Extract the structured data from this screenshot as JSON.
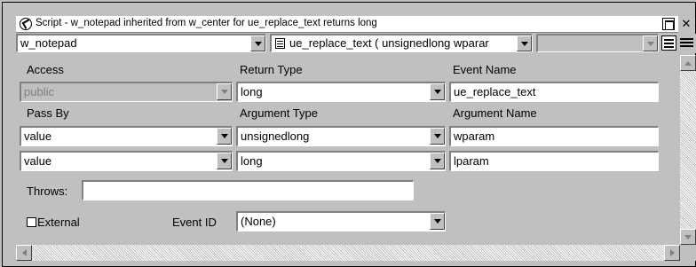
{
  "window": {
    "title": "Script - w_notepad inherited from w_center for ue_replace_text returns long",
    "icon": "script-icon"
  },
  "toolbar": {
    "object_select": "w_notepad",
    "event_select": "ue_replace_text ( unsignedlong wparar",
    "ancestor_select": ""
  },
  "form": {
    "access_label": "Access",
    "access_value": "public",
    "return_type_label": "Return Type",
    "return_type_value": "long",
    "event_name_label": "Event Name",
    "event_name_value": "ue_replace_text",
    "pass_by_label": "Pass By",
    "argument_type_label": "Argument Type",
    "argument_name_label": "Argument Name",
    "arguments": [
      {
        "pass_by": "value",
        "type": "unsignedlong",
        "name": "wparam"
      },
      {
        "pass_by": "value",
        "type": "long",
        "name": "lparam"
      }
    ],
    "throws_label": "Throws:",
    "throws_value": "",
    "external_label": "External",
    "external_checked": false,
    "event_id_label": "Event ID",
    "event_id_value": "(None)"
  },
  "colors": {
    "face": "#c0c0c0",
    "field": "#ffffff",
    "disabled_text": "#808080"
  }
}
